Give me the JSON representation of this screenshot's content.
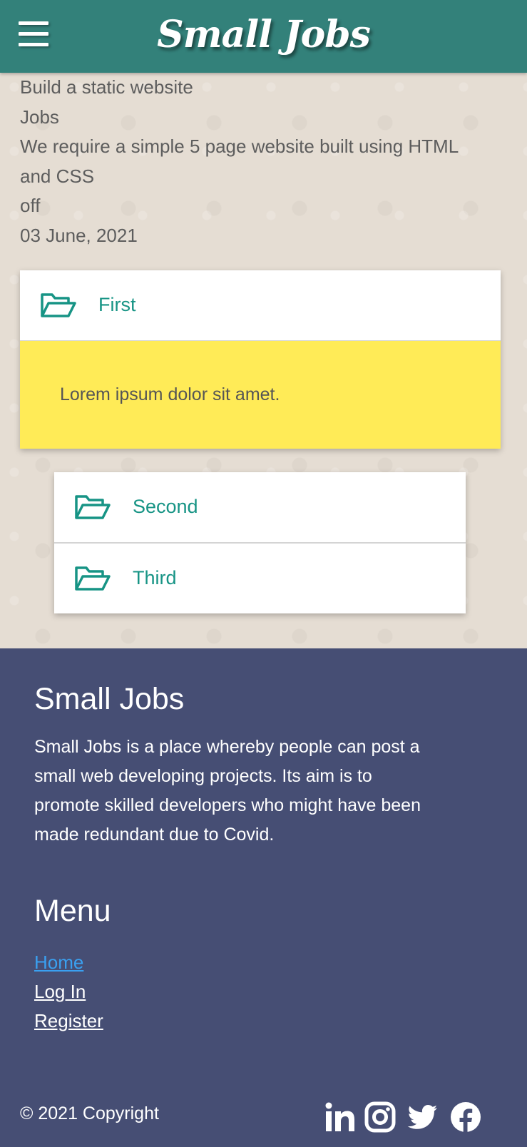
{
  "header": {
    "brand": "Small Jobs",
    "menu_icon": "hamburger-menu-icon",
    "background": "#33817a"
  },
  "job": {
    "title": "Build a static website",
    "category": "Jobs",
    "description_line1": "We require a simple 5 page website built using HTML",
    "description_line2": "and CSS",
    "status": "off",
    "date": "03 June, 2021"
  },
  "accordion": {
    "items": [
      {
        "label": "First",
        "icon": "folder-open-icon",
        "expanded": true,
        "body": "Lorem ipsum dolor sit amet."
      },
      {
        "label": "Second",
        "icon": "folder-open-icon",
        "expanded": false
      },
      {
        "label": "Third",
        "icon": "folder-open-icon",
        "expanded": false
      }
    ],
    "accent": "#179485",
    "body_background": "#ffeb57"
  },
  "footer": {
    "background": "#464e74",
    "about_title": "Small Jobs",
    "about_line1": "Small Jobs is a place whereby people can post a",
    "about_line2": "small web developing projects. Its aim is to",
    "about_line3": "promote skilled developers who might have been",
    "about_line4": "made redundant due to Covid.",
    "menu_title": "Menu",
    "menu": [
      {
        "label": "Home",
        "active": true
      },
      {
        "label": "Log In",
        "active": false
      },
      {
        "label": "Register",
        "active": false
      }
    ],
    "link_active_color": "#3aa0f0",
    "copyright": "© 2021 Copyright",
    "socials": [
      "linkedin-icon",
      "instagram-icon",
      "twitter-icon",
      "facebook-icon"
    ]
  }
}
